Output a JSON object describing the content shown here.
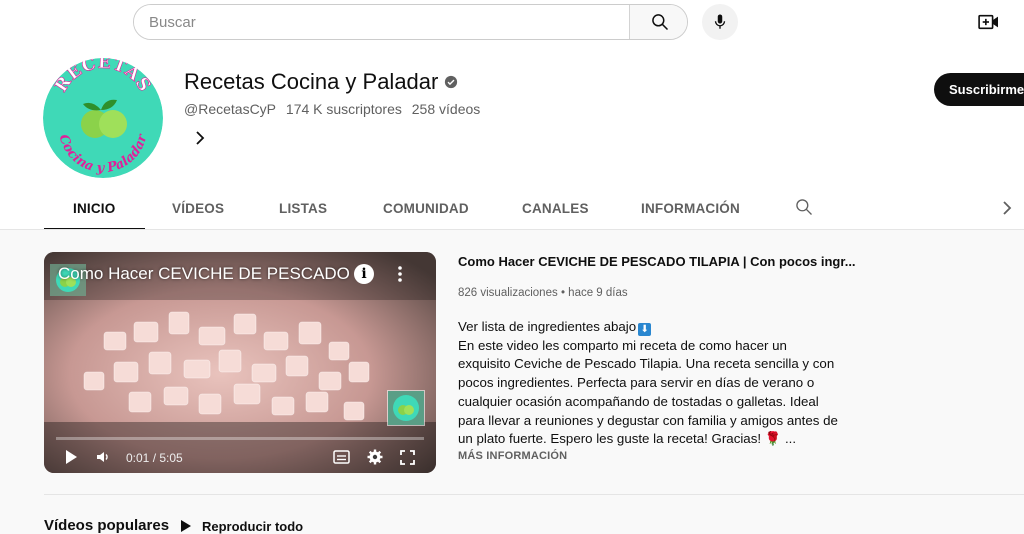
{
  "search": {
    "placeholder": "Buscar"
  },
  "icons": {
    "search": "search-icon",
    "mic": "microphone-icon",
    "create": "video-camera-plus-icon",
    "verified": "verified-check-icon",
    "chevron": "chevron-right-icon",
    "play": "play-icon",
    "volume": "volume-icon",
    "subtitles": "subtitles-icon",
    "settings": "gear-icon",
    "fullscreen": "fullscreen-icon"
  },
  "channel": {
    "avatar_text_top": "RECETAS",
    "avatar_text_bottom": "Cocina y Paladar",
    "name": "Recetas Cocina y Paladar",
    "handle": "@RecetasCyP",
    "subscribers": "174 K suscriptores",
    "videos": "258 vídeos",
    "subscribe_label": "Suscribirme"
  },
  "tabs": [
    {
      "label": "INICIO",
      "active": true
    },
    {
      "label": "VÍDEOS",
      "active": false
    },
    {
      "label": "LISTAS",
      "active": false
    },
    {
      "label": "COMUNIDAD",
      "active": false
    },
    {
      "label": "CANALES",
      "active": false
    },
    {
      "label": "INFORMACIÓN",
      "active": false
    }
  ],
  "featured": {
    "player_title": "Como Hacer CEVICHE DE PESCADO ...",
    "time": "0:01 / 5:05",
    "title": "Como Hacer CEVICHE DE PESCADO TILAPIA | Con pocos ingr...",
    "views": "826 visualizaciones",
    "age": "hace 9 días",
    "description_lines": [
      "Ver lista de ingredientes abajo",
      "En este video les comparto mi receta de como hacer un",
      "exquisito Ceviche de Pescado Tilapia.  Una receta sencilla y con",
      "pocos ingredientes.  Perfecta para servir en días de verano o",
      "cualquier ocasión acompañando de tostadas o galletas.  Ideal",
      "para llevar a reuniones y degustar con familia y amigos antes de",
      "un plato fuerte. Espero les guste la receta! Gracias! 🌹 ..."
    ],
    "more_label": "MÁS INFORMACIÓN"
  },
  "popular": {
    "title": "Vídeos populares",
    "play_all_label": "Reproducir todo"
  },
  "colors": {
    "accent": "#0f0f0f",
    "avatar_bg": "#3fd9b7",
    "avatar_text": "#e0209a",
    "lime": "#8bd24a"
  }
}
